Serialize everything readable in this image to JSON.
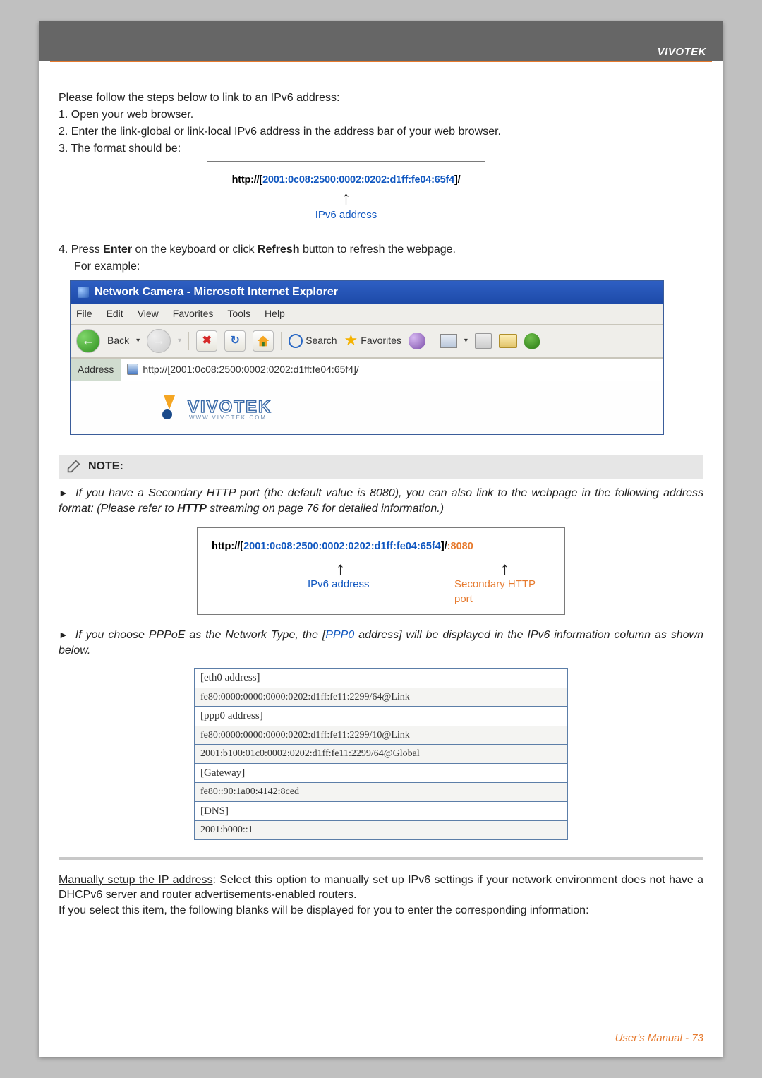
{
  "header": {
    "brand": "VIVOTEK"
  },
  "steps": {
    "intro": "Please follow the steps below to link to an IPv6 address:",
    "s1": "1. Open your web browser.",
    "s2": "2. Enter the link-global or link-local IPv6 address in the address bar of your web browser.",
    "s3": "3. The format should be:",
    "s4a": "4. Press ",
    "enter": "Enter",
    "s4b": " on the keyboard or click ",
    "refresh": "Refresh",
    "s4c": " button to refresh the webpage.",
    "example": "For example:"
  },
  "url1": {
    "prefix": "http://[",
    "ipv6": "2001:0c08:2500:0002:0202:d1ff:fe04:65f4",
    "suffix": "]/",
    "label_ipv6": "IPv6 address"
  },
  "ie": {
    "title": "Network Camera - Microsoft Internet Explorer",
    "menu": {
      "file": "File",
      "edit": "Edit",
      "view": "View",
      "favorites": "Favorites",
      "tools": "Tools",
      "help": "Help"
    },
    "toolbar": {
      "back": "Back",
      "search": "Search",
      "favorites": "Favorites"
    },
    "addr_label": "Address",
    "addr_value": "http://[2001:0c08:2500:0002:0202:d1ff:fe04:65f4]/",
    "logo_word": "VIVOTEK",
    "logo_sub": "WWW.VIVOTEK.COM"
  },
  "note": {
    "heading": "NOTE:",
    "p1_a": "If you have a Secondary HTTP port (the default value is 8080), you can also link to the webpage in the following address format: (Please refer to ",
    "p1_http": "HTTP",
    "p1_b": " streaming on page 76 for detailed information.)",
    "p2_a": "If you choose PPPoE as the Network Type, the [",
    "p2_ppp": "PPP0",
    "p2_b": " address] will be displayed in the IPv6 information column as shown below."
  },
  "url2": {
    "prefix": "http://[",
    "ipv6": "2001:0c08:2500:0002:0202:d1ff:fe04:65f4",
    "mid": "]/",
    "port": ":8080",
    "label_ipv6": "IPv6 address",
    "label_port": "Secondary HTTP port"
  },
  "info": {
    "eth0_hdr": "[eth0 address]",
    "eth0_val": "fe80:0000:0000:0000:0202:d1ff:fe11:2299/64@Link",
    "ppp0_hdr": "[ppp0 address]",
    "ppp0_val1": "fe80:0000:0000:0000:0202:d1ff:fe11:2299/10@Link",
    "ppp0_val2": "2001:b100:01c0:0002:0202:d1ff:fe11:2299/64@Global",
    "gw_hdr": "[Gateway]",
    "gw_val": "fe80::90:1a00:4142:8ced",
    "dns_hdr": "[DNS]",
    "dns_val": "2001:b000::1"
  },
  "manual": {
    "under": "Manually setup the IP address",
    "rest1": ": Select this option to manually set up IPv6 settings if your network environment does not have a DHCPv6 server and router advertisements-enabled routers.",
    "rest2": "If you select this item, the following blanks will be displayed for you to enter the corresponding information:"
  },
  "footer": {
    "text": "User's Manual - 73"
  }
}
